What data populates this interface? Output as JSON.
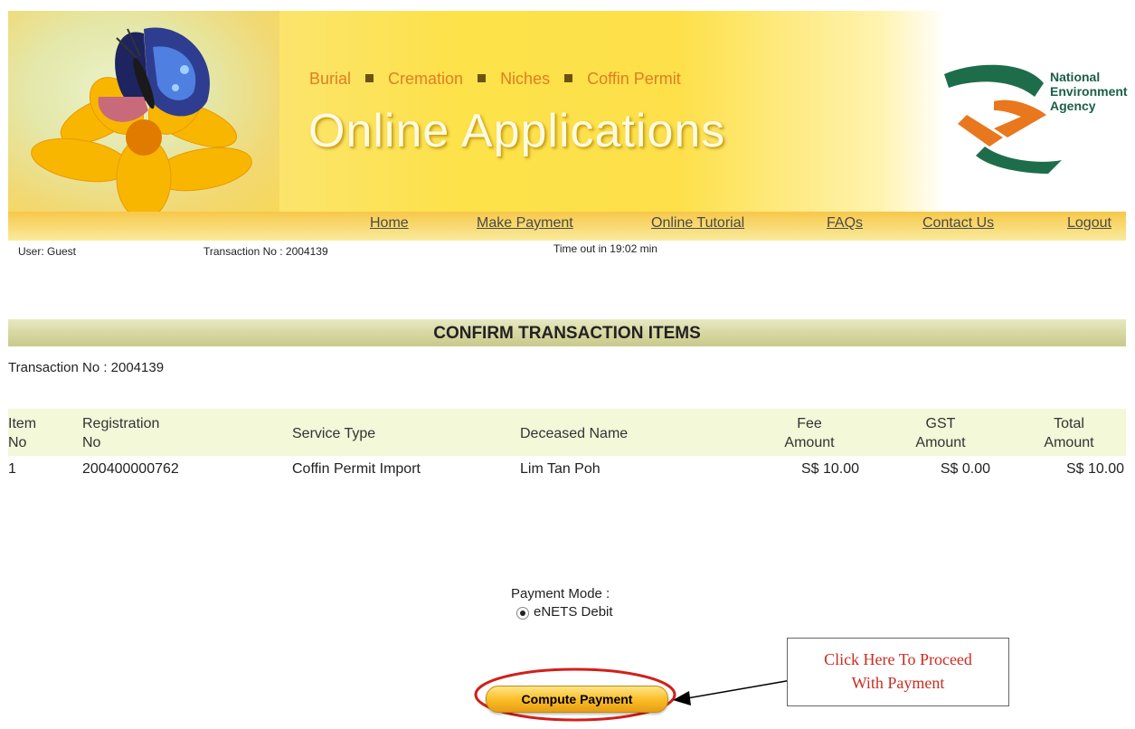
{
  "header": {
    "services": [
      "Burial",
      "Cremation",
      "Niches",
      "Coffin Permit"
    ],
    "title": "Online Applications",
    "agency_lines": [
      "National",
      "Environment",
      "Agency"
    ]
  },
  "nav": {
    "items": [
      "Home",
      "Make Payment",
      "Online Tutorial",
      "FAQs",
      "Contact Us",
      "Logout"
    ]
  },
  "status": {
    "user": "User:  Guest",
    "transaction": "Transaction No :  2004139",
    "timeout": "Time out in 19:02 min"
  },
  "section": {
    "title": "CONFIRM TRANSACTION ITEMS",
    "transaction": "Transaction No : 2004139"
  },
  "table": {
    "headers": [
      [
        "Item",
        "No"
      ],
      [
        "Registration",
        "No"
      ],
      [
        "Service Type"
      ],
      [
        "Deceased Name"
      ],
      [
        "Fee",
        "Amount"
      ],
      [
        "GST",
        "Amount"
      ],
      [
        "Total",
        "Amount"
      ]
    ],
    "rows": [
      [
        "1",
        "200400000762",
        "Coffin Permit Import",
        "Lim Tan Poh",
        "S$ 10.00",
        "S$ 0.00",
        "S$ 10.00"
      ]
    ]
  },
  "payment": {
    "label": "Payment Mode :",
    "options": [
      "eNETS Debit"
    ],
    "selected": "eNETS Debit",
    "button": "Compute Payment"
  },
  "callout": {
    "lines": [
      "Click Here To Proceed",
      "With Payment"
    ],
    "color": "#cc2b1f"
  },
  "colors": {
    "banner": "#fde04a",
    "nav": "#f8d66b",
    "service_text": "#e07d22",
    "table_header": "#f2f8d8"
  }
}
